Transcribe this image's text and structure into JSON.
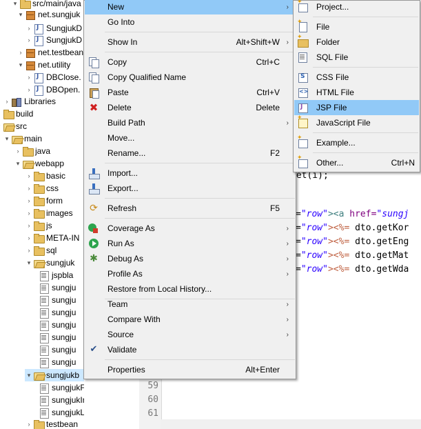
{
  "tree": {
    "items": [
      {
        "label": "src/main/java",
        "icon": "folder-icon"
      },
      {
        "label": "net.sungjuk",
        "icon": "package-icon"
      },
      {
        "label": "SungjukD",
        "icon": "java-file-icon"
      },
      {
        "label": "SungjukD",
        "icon": "java-file-icon"
      },
      {
        "label": "net.testbean",
        "icon": "package-icon"
      },
      {
        "label": "net.utility",
        "icon": "package-icon"
      },
      {
        "label": "DBClose.",
        "icon": "java-file-icon"
      },
      {
        "label": "DBOpen.",
        "icon": "java-file-icon"
      },
      {
        "label": "Libraries",
        "icon": "library-icon"
      },
      {
        "label": "build",
        "icon": "folder-icon"
      },
      {
        "label": "src",
        "icon": "folder-icon"
      },
      {
        "label": "main",
        "icon": "folder-icon"
      },
      {
        "label": "java",
        "icon": "folder-icon"
      },
      {
        "label": "webapp",
        "icon": "folder-icon"
      },
      {
        "label": "basic",
        "icon": "folder-icon"
      },
      {
        "label": "css",
        "icon": "folder-icon"
      },
      {
        "label": "form",
        "icon": "folder-icon"
      },
      {
        "label": "images",
        "icon": "folder-icon"
      },
      {
        "label": "js",
        "icon": "folder-icon"
      },
      {
        "label": "META-IN",
        "icon": "folder-icon"
      },
      {
        "label": "sql",
        "icon": "folder-icon"
      },
      {
        "label": "sungjuk",
        "icon": "folder-icon"
      },
      {
        "label": "jspbla",
        "icon": "jsp-file-icon"
      },
      {
        "label": "sungju",
        "icon": "jsp-file-icon"
      },
      {
        "label": "sungju",
        "icon": "jsp-file-icon"
      },
      {
        "label": "sungju",
        "icon": "jsp-file-icon"
      },
      {
        "label": "sungju",
        "icon": "jsp-file-icon"
      },
      {
        "label": "sungju",
        "icon": "jsp-file-icon"
      },
      {
        "label": "sungju",
        "icon": "jsp-file-icon"
      },
      {
        "label": "sungju",
        "icon": "jsp-file-icon"
      },
      {
        "label": "sungjukb",
        "icon": "folder-icon"
      },
      {
        "label": "sungjukForm.jsp",
        "icon": "jsp-file-icon"
      },
      {
        "label": "sungjukIns.jsp",
        "icon": "jsp-file-icon"
      },
      {
        "label": "sungjukList.jsp",
        "icon": "jsp-file-icon"
      },
      {
        "label": "testbean",
        "icon": "folder-icon"
      }
    ]
  },
  "editor": {
    "line_numbers": [
      "59",
      "60",
      "61"
    ],
    "code": {
      "line_get": "get(i);",
      "line1_eq": "=",
      "line1_str": "\"row\"",
      "line1_tag": "><a ",
      "line1_attr": "href=",
      "line1_str2": "\"sungj",
      "line2_eq": "=",
      "line2_str": "\"row\"",
      "line2_scr": "><%=",
      "line2_rest": " dto.getKor",
      "line3_eq": "=",
      "line3_str": "\"row\"",
      "line3_scr": "><%=",
      "line3_rest": " dto.getEng",
      "line4_eq": "=",
      "line4_str": "\"row\"",
      "line4_scr": "><%=",
      "line4_rest": " dto.getMat",
      "line5_eq": "=",
      "line5_str": "\"row\"",
      "line5_scr": "><%=",
      "line5_rest": " dto.getWda"
    }
  },
  "context_menu": {
    "items": [
      {
        "label": "New",
        "shortcut": "",
        "submenu": true,
        "icon": ""
      },
      {
        "label": "Go Into",
        "shortcut": "",
        "submenu": false,
        "icon": ""
      },
      {
        "label": "Show In",
        "shortcut": "Alt+Shift+W",
        "submenu": true,
        "icon": ""
      },
      {
        "label": "Copy",
        "shortcut": "Ctrl+C",
        "submenu": false,
        "icon": "copy-icon"
      },
      {
        "label": "Copy Qualified Name",
        "shortcut": "",
        "submenu": false,
        "icon": "copy-icon"
      },
      {
        "label": "Paste",
        "shortcut": "Ctrl+V",
        "submenu": false,
        "icon": "paste-icon"
      },
      {
        "label": "Delete",
        "shortcut": "Delete",
        "submenu": false,
        "icon": "delete-icon"
      },
      {
        "label": "Build Path",
        "shortcut": "",
        "submenu": true,
        "icon": ""
      },
      {
        "label": "Move...",
        "shortcut": "",
        "submenu": false,
        "icon": ""
      },
      {
        "label": "Rename...",
        "shortcut": "F2",
        "submenu": false,
        "icon": ""
      },
      {
        "label": "Import...",
        "shortcut": "",
        "submenu": false,
        "icon": "import-icon"
      },
      {
        "label": "Export...",
        "shortcut": "",
        "submenu": false,
        "icon": "export-icon"
      },
      {
        "label": "Refresh",
        "shortcut": "F5",
        "submenu": false,
        "icon": "refresh-icon"
      },
      {
        "label": "Coverage As",
        "shortcut": "",
        "submenu": true,
        "icon": "coverage-icon"
      },
      {
        "label": "Run As",
        "shortcut": "",
        "submenu": true,
        "icon": "run-icon"
      },
      {
        "label": "Debug As",
        "shortcut": "",
        "submenu": true,
        "icon": "debug-icon"
      },
      {
        "label": "Profile As",
        "shortcut": "",
        "submenu": true,
        "icon": ""
      },
      {
        "label": "Restore from Local History...",
        "shortcut": "",
        "submenu": false,
        "icon": ""
      },
      {
        "label": "Team",
        "shortcut": "",
        "submenu": true,
        "icon": ""
      },
      {
        "label": "Compare With",
        "shortcut": "",
        "submenu": true,
        "icon": ""
      },
      {
        "label": "Source",
        "shortcut": "",
        "submenu": true,
        "icon": ""
      },
      {
        "label": "Validate",
        "shortcut": "",
        "submenu": false,
        "icon": "check-icon"
      },
      {
        "label": "Properties",
        "shortcut": "Alt+Enter",
        "submenu": false,
        "icon": ""
      }
    ]
  },
  "submenu": {
    "items": [
      {
        "label": "Project...",
        "shortcut": "",
        "icon": "new-project-icon"
      },
      {
        "label": "File",
        "shortcut": "",
        "icon": "new-file-icon"
      },
      {
        "label": "Folder",
        "shortcut": "",
        "icon": "new-folder-icon"
      },
      {
        "label": "SQL File",
        "shortcut": "",
        "icon": "sql-file-icon"
      },
      {
        "label": "CSS File",
        "shortcut": "",
        "icon": "css-file-icon"
      },
      {
        "label": "HTML File",
        "shortcut": "",
        "icon": "html-file-icon"
      },
      {
        "label": "JSP File",
        "shortcut": "",
        "icon": "jsp-file-icon"
      },
      {
        "label": "JavaScript File",
        "shortcut": "",
        "icon": "javascript-file-icon"
      },
      {
        "label": "Example...",
        "shortcut": "",
        "icon": "example-icon"
      },
      {
        "label": "Other...",
        "shortcut": "Ctrl+N",
        "icon": "other-wizard-icon"
      }
    ]
  },
  "colors": {
    "menu_background": "#f0f0f0",
    "menu_highlight": "#91c9f7",
    "tree_selection": "#cce8ff",
    "string_color": "#2a00ff",
    "scriptlet_color": "#bf5f3f"
  }
}
